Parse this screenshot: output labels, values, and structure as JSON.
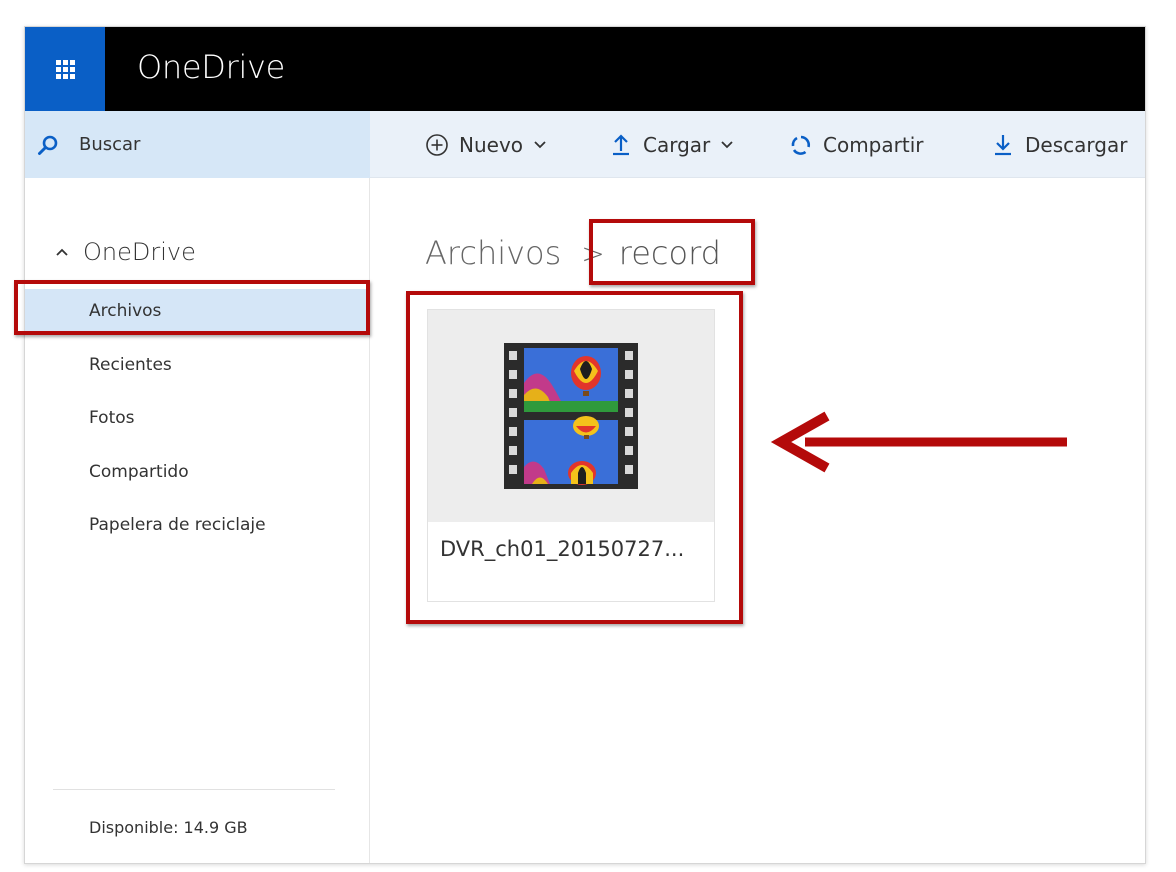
{
  "app": {
    "title": "OneDrive"
  },
  "command_bar": {
    "search_label": "Buscar",
    "new_label": "Nuevo",
    "upload_label": "Cargar",
    "share_label": "Compartir",
    "download_label": "Descargar"
  },
  "sidebar": {
    "root_label": "OneDrive",
    "items": [
      {
        "label": "Archivos",
        "active": true
      },
      {
        "label": "Recientes",
        "active": false
      },
      {
        "label": "Fotos",
        "active": false
      },
      {
        "label": "Compartido",
        "active": false
      },
      {
        "label": "Papelera de reciclaje",
        "active": false
      }
    ],
    "storage_text": "Disponible: 14.9 GB"
  },
  "breadcrumb": {
    "root": "Archivos",
    "separator": ">",
    "current": "record"
  },
  "files": [
    {
      "name": "DVR_ch01_20150727...",
      "icon": "video-file-icon"
    }
  ],
  "colors": {
    "app_bar": "#000000",
    "waffle": "#0a5fc6",
    "command_bar": "#eaf1f9",
    "active_nav": "#d5e6f7",
    "annotation": "#b40a0a"
  }
}
